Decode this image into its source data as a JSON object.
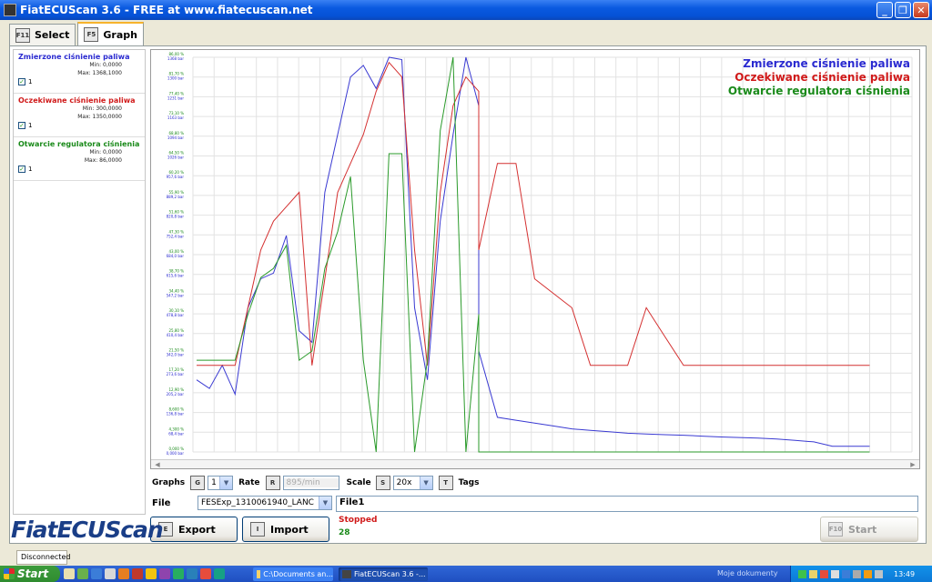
{
  "window": {
    "title": "FiatECUScan 3.6 - FREE at www.fiatecuscan.net"
  },
  "tabs": [
    {
      "key": "F11",
      "label": "Select"
    },
    {
      "key": "F5",
      "label": "Graph"
    }
  ],
  "legend": [
    {
      "name": "Zmierzone ciśnienie paliwa",
      "min": "Min: 0,0000",
      "max": "Max: 1368,1000",
      "color": "#2a2ad0",
      "checkbox": "1"
    },
    {
      "name": "Oczekiwane ciśnienie paliwa",
      "min": "Min: 300,0000",
      "max": "Max: 1350,0000",
      "color": "#d01a1a",
      "checkbox": "1"
    },
    {
      "name": "Otwarcie regulatora ciśnienia",
      "min": "Min: 0,0000",
      "max": "Max: 86,0000",
      "color": "#1a8a1a",
      "checkbox": "1"
    }
  ],
  "chart_data": {
    "type": "line",
    "series": [
      {
        "name": "Zmierzone ciśnienie paliwa",
        "color": "#3a3ad2",
        "values": [
          250,
          220,
          300,
          200,
          500,
          600,
          620,
          750,
          420,
          380,
          900,
          1100,
          1300,
          1340,
          1260,
          1368,
          1360,
          500,
          250,
          800,
          1100,
          1368,
          1200,
          350,
          120,
          110,
          100,
          90,
          80,
          75,
          70,
          65,
          62,
          60,
          58,
          55,
          52,
          50,
          48,
          45,
          40,
          35,
          20,
          20,
          20
        ]
      },
      {
        "name": "Oczekiwane ciśnienie paliwa",
        "color": "#d43030",
        "values": [
          300,
          300,
          300,
          300,
          500,
          700,
          800,
          850,
          900,
          300,
          600,
          900,
          1000,
          1100,
          1250,
          1350,
          1300,
          700,
          300,
          900,
          1200,
          1300,
          1250,
          700,
          1000,
          1000,
          600,
          550,
          500,
          300,
          300,
          300,
          500,
          400,
          300,
          300,
          300,
          300,
          300,
          300,
          300,
          300,
          300,
          300,
          300
        ]
      },
      {
        "name": "Otwarcie regulatora ciśnienia",
        "color": "#2a9a2a",
        "values": [
          20,
          20,
          20,
          20,
          30,
          38,
          40,
          45,
          20,
          22,
          40,
          48,
          60,
          20,
          0,
          65,
          65,
          0,
          20,
          70,
          86,
          0,
          30,
          0,
          0,
          0,
          0,
          0,
          0,
          0,
          0,
          0,
          0,
          0,
          0,
          0,
          0,
          0,
          0,
          0,
          0,
          0,
          0,
          0,
          0
        ]
      }
    ],
    "ylim_pressure": [
      0,
      1368
    ],
    "ylim_opening": [
      0,
      86
    ],
    "grid": true,
    "legend_position": "top-right",
    "y_tick_labels_green": [
      "0,000 %",
      "4,300 %",
      "8,600 %",
      "12,90 %",
      "17,20 %",
      "21,50 %",
      "25,80 %",
      "30,10 %",
      "34,40 %",
      "38,70 %",
      "43,00 %",
      "47,30 %",
      "51,60 %",
      "55,90 %",
      "60,20 %",
      "64,50 %",
      "68,80 %",
      "73,10 %",
      "77,40 %",
      "81,70 %",
      "86,00 %"
    ],
    "y_tick_labels_blue": [
      "0,000 bar",
      "68,4 bar",
      "136,8 bar",
      "205,2 bar",
      "273,6 bar",
      "342,0 bar",
      "410,4 bar",
      "478,8 bar",
      "547,2 bar",
      "615,6 bar",
      "684,0 bar",
      "752,4 bar",
      "820,8 bar",
      "889,2 bar",
      "957,6 bar",
      "1026 bar",
      "1094 bar",
      "1163 bar",
      "1231 bar",
      "1300 bar",
      "1368 bar"
    ]
  },
  "controls": {
    "graphs_label": "Graphs",
    "graphs_key": "G",
    "graphs_value": "1",
    "rate_label": "Rate",
    "rate_key": "R",
    "rate_value": "895/min",
    "scale_label": "Scale",
    "scale_key": "S",
    "scale_value": "20x",
    "tags_key": "T",
    "tags_label": "Tags"
  },
  "file": {
    "label": "File",
    "value": "FESExp_1310061940_LANC",
    "export_key": "E",
    "export_label": "Export",
    "import_key": "I",
    "import_label": "Import"
  },
  "status": {
    "file_name": "File1",
    "state": "Stopped",
    "count": "28",
    "start_key": "F10",
    "start_label": "Start"
  },
  "logo": "FiatECUScan",
  "statusbar": {
    "connection": "Disconnected"
  },
  "taskbar": {
    "start_label": "Start",
    "tasks": [
      "C:\\Documents an...",
      "FiatECUScan 3.6 -..."
    ],
    "tray_label": "Moje dokumenty",
    "clock": "13:49"
  }
}
